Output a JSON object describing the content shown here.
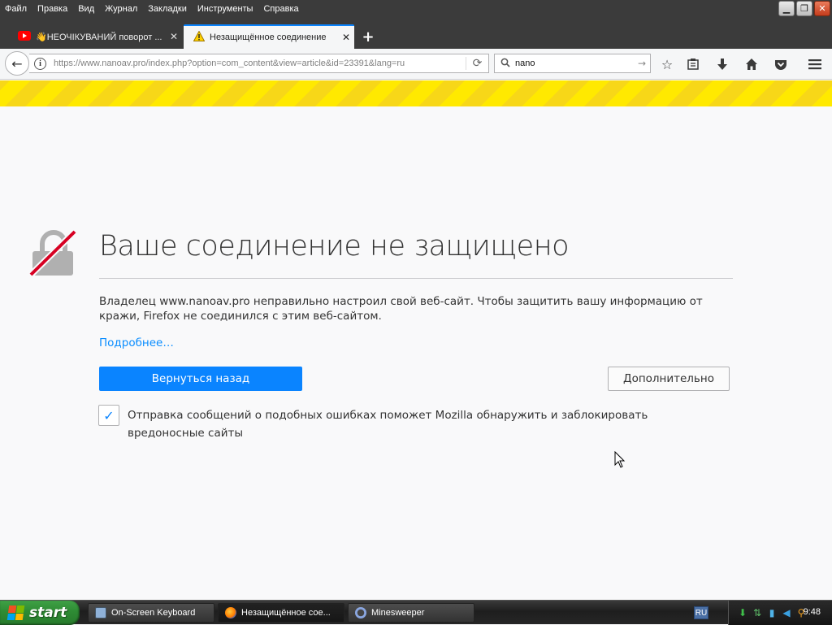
{
  "menubar": {
    "items": [
      "Файл",
      "Правка",
      "Вид",
      "Журнал",
      "Закладки",
      "Инструменты",
      "Справка"
    ],
    "window_controls": {
      "minimize": "▁",
      "restore": "❐",
      "close": "✕"
    }
  },
  "tabs": [
    {
      "title": "👋НЕОЧІКУВАНИЙ поворот ...",
      "icon": "youtube-icon",
      "close": "✕"
    },
    {
      "title": "Незащищённое соединение",
      "icon": "warning-icon",
      "close": "✕"
    }
  ],
  "new_tab": "+",
  "navbar": {
    "url": "https://www.nanoav.pro/index.php?option=com_content&view=article&id=23391&lang=ru",
    "search_value": "nano",
    "icons": [
      "back-icon",
      "info-icon",
      "reload-icon",
      "search-icon",
      "bookmark-star-icon",
      "reading-list-icon",
      "download-icon",
      "home-icon",
      "pocket-icon",
      "menu-icon"
    ]
  },
  "page": {
    "title": "Ваше соединение не защищено",
    "description": "Владелец www.nanoav.pro неправильно настроил свой веб-сайт. Чтобы защитить вашу информацию от кражи, Firefox не соединился с этим веб-сайтом.",
    "learn_more": "Подробнее…",
    "back_button": "Вернуться назад",
    "advanced_button": "Дополнительно",
    "report_checkbox_checked": true,
    "report_label": "Отправка сообщений о подобных ошибках поможет Mozilla обнаружить и заблокировать вредоносные сайты"
  },
  "taskbar": {
    "start": "start",
    "items": [
      {
        "label": "On-Screen Keyboard",
        "icon": "keyboard-icon"
      },
      {
        "label": "Незащищённое сое...",
        "icon": "firefox-icon"
      },
      {
        "label": "Minesweeper",
        "icon": "minesweeper-icon"
      }
    ],
    "language": "RU",
    "clock": "9:48"
  },
  "colors": {
    "accent": "#0a84ff",
    "warning_stripe": "#ffe900",
    "lock_stroke": "#d70022"
  }
}
